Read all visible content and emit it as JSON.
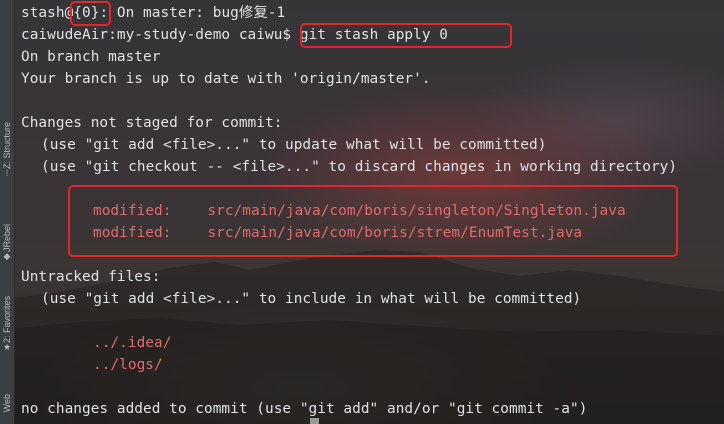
{
  "sidebar": {
    "items": [
      {
        "label": "Z: Structure",
        "icon": "structure-icon",
        "glyph": "⁝"
      },
      {
        "label": "JRebel",
        "icon": "jrebel-icon",
        "glyph": "◆"
      },
      {
        "label": "2: Favorites",
        "icon": "favorites-star-icon",
        "glyph": "★"
      },
      {
        "label": "Web",
        "icon": "web-icon",
        "glyph": ""
      }
    ]
  },
  "terminal": {
    "stash_ref_prefix": "stash@",
    "stash_ref_index": "{0}",
    "stash_ref_suffix": ": On master: bug修复-1",
    "prompt": "caiwudeAir:my-study-demo caiwu$",
    "command": " git stash apply 0",
    "branch_line": "On branch master",
    "status_line": "Your branch is up to date with 'origin/master'.",
    "changes_header": "Changes not staged for commit:",
    "hint_add": "(use \"git add <file>...\" to update what will be committed)",
    "hint_checkout": "(use \"git checkout -- <file>...\" to discard changes in working directory)",
    "modified_files": [
      {
        "status": "modified:",
        "path": "src/main/java/com/boris/singleton/Singleton.java"
      },
      {
        "status": "modified:",
        "path": "src/main/java/com/boris/strem/EnumTest.java"
      }
    ],
    "untracked_header": "Untracked files:",
    "hint_untracked": "(use \"git add <file>...\" to include in what will be committed)",
    "untracked_files": [
      "../.idea/",
      "../logs/"
    ],
    "summary_line": "no changes added to commit (use \"git add\" and/or \"git commit -a\")"
  },
  "colors": {
    "highlight_box": "#e4262a",
    "modified_text": "#e26a6a",
    "terminal_text": "#e2e2e2"
  }
}
